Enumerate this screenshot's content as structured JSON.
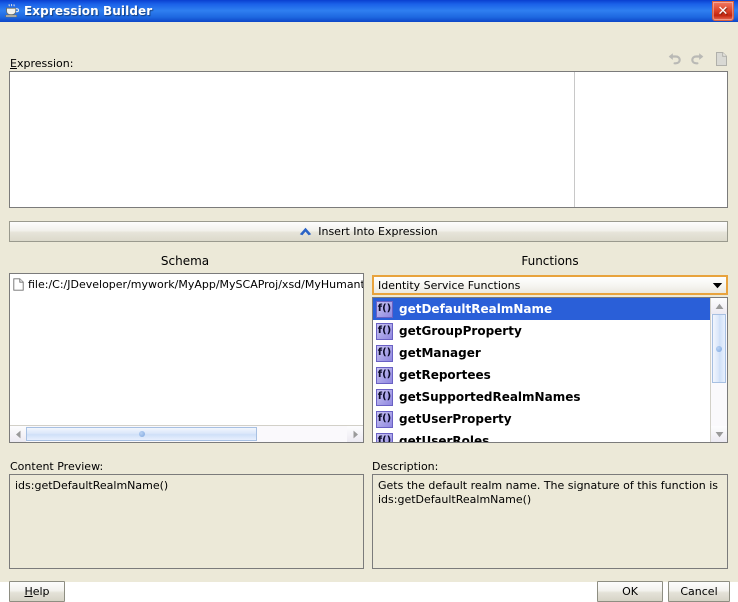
{
  "window": {
    "title": "Expression Builder",
    "icon": "java-coffee-cup-icon",
    "close_label": "✕"
  },
  "expression": {
    "label": "Expression:",
    "label_mnemonic": "E",
    "label_rest": "xpression:",
    "value": "",
    "side_value": "",
    "tools": [
      {
        "name": "undo-icon",
        "title": "Undo"
      },
      {
        "name": "redo-icon",
        "title": "Redo"
      },
      {
        "name": "clear-document-icon",
        "title": "Clear"
      }
    ]
  },
  "insert_button": {
    "label": "Insert Into Expression",
    "icon": "chevron-up-icon",
    "icon_color": "#2b63c6"
  },
  "schema": {
    "heading": "Schema",
    "tree": [
      {
        "icon": "document-icon",
        "label": "file:/C:/JDeveloper/mywork/MyApp/MySCAProj/xsd/MyHumantaskWo"
      }
    ]
  },
  "functions": {
    "heading": "Functions",
    "category_selected": "Identity Service Functions",
    "category_options": [
      "Identity Service Functions"
    ],
    "items": [
      {
        "icon": "function-icon",
        "label": "getDefaultRealmName",
        "selected": true
      },
      {
        "icon": "function-icon",
        "label": "getGroupProperty",
        "selected": false
      },
      {
        "icon": "function-icon",
        "label": "getManager",
        "selected": false
      },
      {
        "icon": "function-icon",
        "label": "getReportees",
        "selected": false
      },
      {
        "icon": "function-icon",
        "label": "getSupportedRealmNames",
        "selected": false
      },
      {
        "icon": "function-icon",
        "label": "getUserProperty",
        "selected": false
      },
      {
        "icon": "function-icon",
        "label": "getUserRoles",
        "selected": false
      }
    ],
    "selection_color": "#2a5fd8"
  },
  "content_preview": {
    "label": "Content Preview:",
    "value": "ids:getDefaultRealmName()"
  },
  "description": {
    "label": "Description:",
    "value": "Gets the default realm name. The signature of this function is ids:getDefaultRealmName()"
  },
  "footer": {
    "help_mnemonic": "H",
    "help_rest": "elp",
    "help_label": "Help",
    "ok_label": "OK",
    "cancel_label": "Cancel"
  }
}
